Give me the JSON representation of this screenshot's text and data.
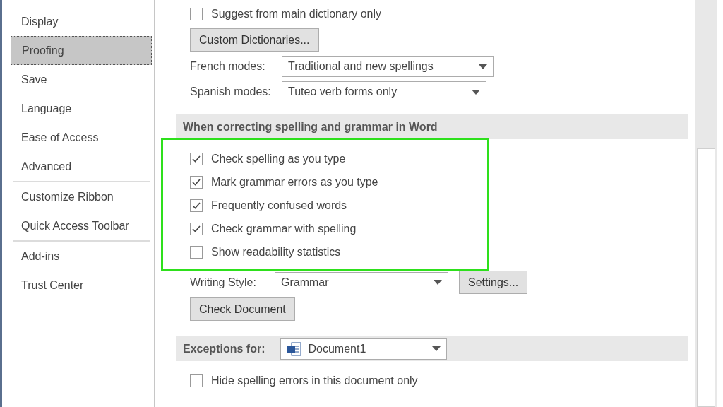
{
  "sidebar": {
    "items": [
      {
        "label": "Display",
        "selected": false,
        "divider_after": false
      },
      {
        "label": "Proofing",
        "selected": true,
        "divider_after": false
      },
      {
        "label": "Save",
        "selected": false,
        "divider_after": false
      },
      {
        "label": "Language",
        "selected": false,
        "divider_after": false
      },
      {
        "label": "Ease of Access",
        "selected": false,
        "divider_after": false
      },
      {
        "label": "Advanced",
        "selected": false,
        "divider_after": true
      },
      {
        "label": "Customize Ribbon",
        "selected": false,
        "divider_after": false
      },
      {
        "label": "Quick Access Toolbar",
        "selected": false,
        "divider_after": true
      },
      {
        "label": "Add-ins",
        "selected": false,
        "divider_after": false
      },
      {
        "label": "Trust Center",
        "selected": false,
        "divider_after": false
      }
    ]
  },
  "office_options": {
    "suggest_main": {
      "label": "Suggest from main dictionary only",
      "checked": false
    },
    "custom_dictionaries_button": "Custom Dictionaries...",
    "modes": [
      {
        "label": "French modes:",
        "value": "Traditional and new spellings"
      },
      {
        "label": "Spanish modes:",
        "value": "Tuteo verb forms only"
      }
    ]
  },
  "word_section": {
    "heading": "When correcting spelling and grammar in Word",
    "options": [
      {
        "label": "Check spelling as you type",
        "checked": true
      },
      {
        "label": "Mark grammar errors as you type",
        "checked": true
      },
      {
        "label": "Frequently confused words",
        "checked": true
      },
      {
        "label": "Check grammar with spelling",
        "checked": true
      },
      {
        "label": "Show readability statistics",
        "checked": false
      }
    ],
    "highlighted": true,
    "writing_style": {
      "label": "Writing Style:",
      "value": "Grammar"
    },
    "settings_button": "Settings...",
    "check_document_button": "Check Document"
  },
  "exceptions": {
    "label": "Exceptions for:",
    "document": "Document1",
    "options": [
      {
        "label": "Hide spelling errors in this document only",
        "checked": false
      }
    ]
  }
}
